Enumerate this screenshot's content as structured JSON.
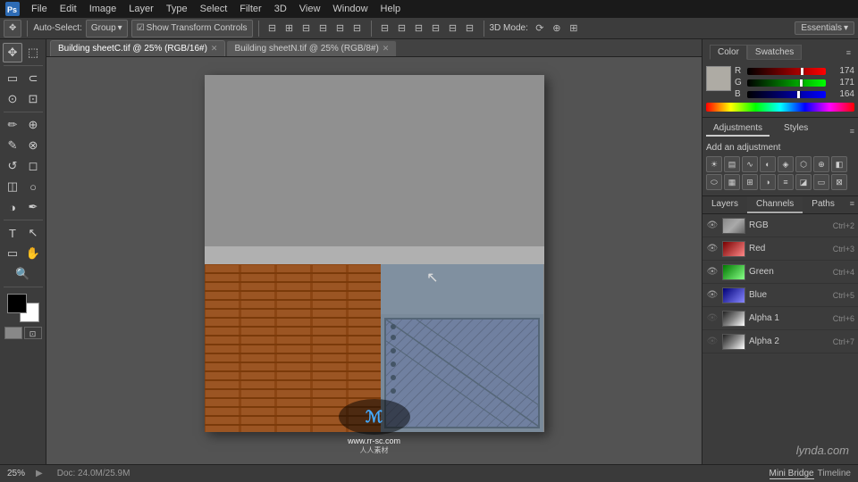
{
  "menubar": {
    "items": [
      "Ps",
      "File",
      "Edit",
      "Image",
      "Layer",
      "Type",
      "Select",
      "Filter",
      "3D",
      "View",
      "Window",
      "Help"
    ]
  },
  "toolbar": {
    "auto_select_label": "Auto-Select:",
    "group_label": "Group",
    "transform_label": "Show Transform Controls",
    "3d_mode_label": "3D Mode:",
    "essentials_label": "Essentials"
  },
  "tabs": [
    {
      "label": "Building sheetC.tif @ 25% (RGB/16#)",
      "active": true
    },
    {
      "label": "Building sheetN.tif @ 25% (RGB/8#)",
      "active": false
    }
  ],
  "color_panel": {
    "title": "Color",
    "tabs": [
      "Color",
      "Swatches"
    ],
    "r_value": "174",
    "g_value": "171",
    "b_value": "164",
    "r_pct": 0.68,
    "g_pct": 0.67,
    "b_pct": 0.64
  },
  "adjustments_panel": {
    "title": "Adjustments",
    "tabs": [
      "Adjustments",
      "Styles"
    ],
    "subtitle": "Add an adjustment"
  },
  "layers_panel": {
    "tabs": [
      "Layers",
      "Channels",
      "Paths"
    ],
    "active_tab": "Channels",
    "channels": [
      {
        "name": "RGB",
        "shortcut": "Ctrl+2",
        "visible": true,
        "selected": false,
        "thumb": "rgb"
      },
      {
        "name": "Red",
        "shortcut": "Ctrl+3",
        "visible": true,
        "selected": false,
        "thumb": "red"
      },
      {
        "name": "Green",
        "shortcut": "Ctrl+4",
        "visible": true,
        "selected": false,
        "thumb": "green"
      },
      {
        "name": "Blue",
        "shortcut": "Ctrl+5",
        "visible": true,
        "selected": false,
        "thumb": "blue"
      },
      {
        "name": "Alpha 1",
        "shortcut": "Ctrl+6",
        "visible": false,
        "selected": false,
        "thumb": "alpha"
      },
      {
        "name": "Alpha 2",
        "shortcut": "Ctrl+7",
        "visible": false,
        "selected": false,
        "thumb": "alpha"
      }
    ]
  },
  "bottom": {
    "zoom": "25%",
    "doc_size": "Doc: 24.0M/25.9M",
    "tabs": [
      "Mini Bridge",
      "Timeline"
    ]
  },
  "watermarks": {
    "left_text": "www.rr-sc.com",
    "right_text": "lynda.com"
  }
}
